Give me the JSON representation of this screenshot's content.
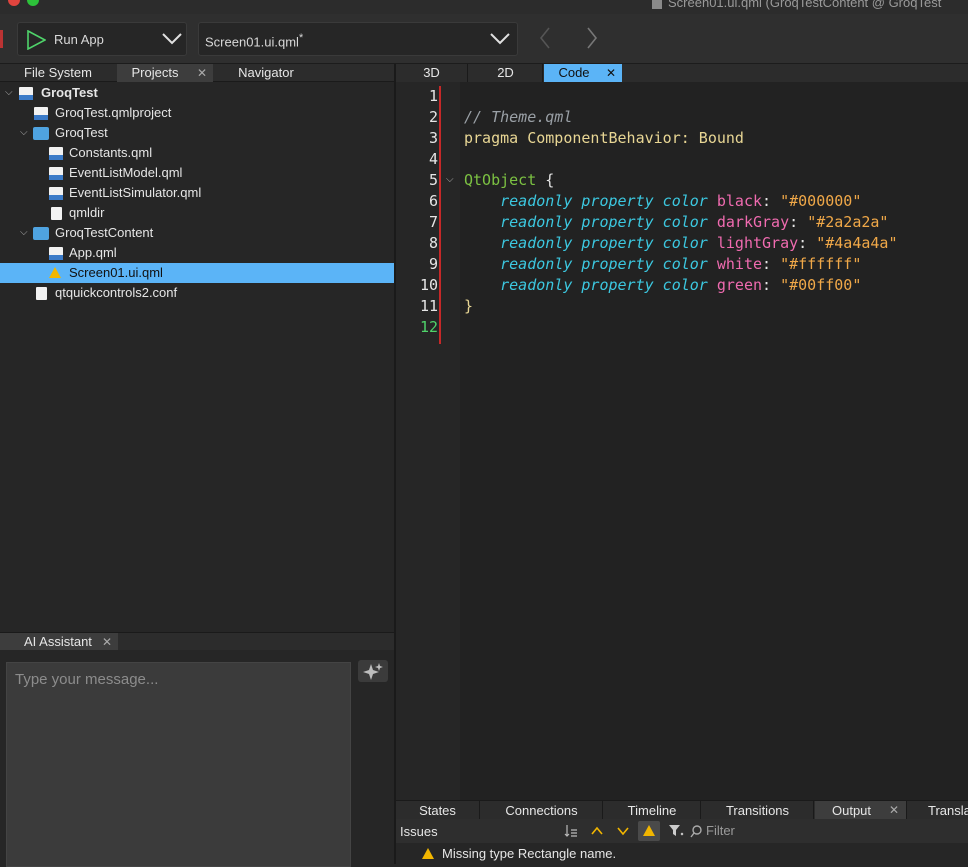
{
  "window": {
    "title": "Screen01.ui.qml (GroqTestContent @ GroqTest"
  },
  "toolbar": {
    "run_label": "Run App",
    "document": "Screen01.ui.qml",
    "modified_marker": "*"
  },
  "left_tabs": [
    {
      "label": "File System"
    },
    {
      "label": "Projects"
    },
    {
      "label": "Navigator"
    }
  ],
  "tree": [
    {
      "label": "GroqTest",
      "type": "project",
      "bold": true
    },
    {
      "label": "GroqTest.qmlproject",
      "type": "qmlproject"
    },
    {
      "label": "GroqTest",
      "type": "folder"
    },
    {
      "label": "Constants.qml",
      "type": "qml"
    },
    {
      "label": "EventListModel.qml",
      "type": "qml"
    },
    {
      "label": "EventListSimulator.qml",
      "type": "qml"
    },
    {
      "label": "qmldir",
      "type": "file"
    },
    {
      "label": "GroqTestContent",
      "type": "folder"
    },
    {
      "label": "App.qml",
      "type": "qml"
    },
    {
      "label": "Screen01.ui.qml",
      "type": "warning",
      "selected": true
    },
    {
      "label": "qtquickcontrols2.conf",
      "type": "file"
    }
  ],
  "ai_assistant": {
    "tab_label": "AI Assistant",
    "placeholder": "Type your message..."
  },
  "editor_tabs": [
    {
      "label": "3D"
    },
    {
      "label": "2D"
    },
    {
      "label": "Code",
      "selected": true
    }
  ],
  "code": {
    "line_numbers": [
      "1",
      "2",
      "3",
      "4",
      "5",
      "6",
      "7",
      "8",
      "9",
      "10",
      "11",
      "12"
    ],
    "current_line": "12",
    "comment": "// Theme.qml",
    "pragma": "pragma",
    "pragma_rest": "ComponentBehavior: Bound",
    "object_type": "QtObject",
    "open_brace": "{",
    "close_brace": "}",
    "prop_prefix": "readonly property color",
    "properties": [
      {
        "name": "black",
        "value": "\"#000000\""
      },
      {
        "name": "darkGray",
        "value": "\"#2a2a2a\""
      },
      {
        "name": "lightGray",
        "value": "\"#4a4a4a\""
      },
      {
        "name": "white",
        "value": "\"#ffffff\""
      },
      {
        "name": "green",
        "value": "\"#00ff00\""
      }
    ]
  },
  "bottom_tabs": [
    {
      "label": "States"
    },
    {
      "label": "Connections"
    },
    {
      "label": "Timeline"
    },
    {
      "label": "Transitions"
    },
    {
      "label": "Output",
      "selected": true
    },
    {
      "label": "Transla"
    }
  ],
  "issues": {
    "title": "Issues",
    "filter_placeholder": "Filter",
    "items": [
      {
        "text": "Missing type Rectangle name."
      }
    ]
  },
  "colors": {
    "accent": "#5bb4f7",
    "warning": "#f2b600",
    "run_green": "#4fd36a"
  }
}
